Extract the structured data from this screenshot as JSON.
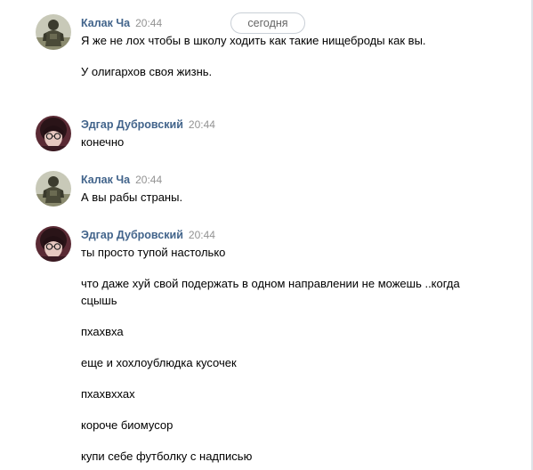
{
  "date_divider": "сегодня",
  "messages": [
    {
      "author": "Калак Ча",
      "time": "20:44",
      "avatar": "soldier-avatar",
      "lines": [
        "Я же не лох чтобы в школу ходить как такие нищеброды как вы.",
        "У олигархов своя жизнь."
      ]
    },
    {
      "author": "Эдгар Дубровский",
      "time": "20:44",
      "avatar": "person-glasses-avatar",
      "lines": [
        "конечно"
      ]
    },
    {
      "author": "Калак Ча",
      "time": "20:44",
      "avatar": "soldier-avatar",
      "lines": [
        "А вы рабы страны."
      ]
    },
    {
      "author": "Эдгар Дубровский",
      "time": "20:44",
      "avatar": "person-glasses-avatar",
      "lines": [
        "ты просто тупой настолько",
        "что даже хуй свой подержать в одном направлении не можешь ..когда сцышь",
        "пхахвха",
        "еще и хохлоублюдка кусочек",
        "пхахвххах",
        "короче биомусор",
        "купи себе футболку с надписью"
      ]
    }
  ]
}
